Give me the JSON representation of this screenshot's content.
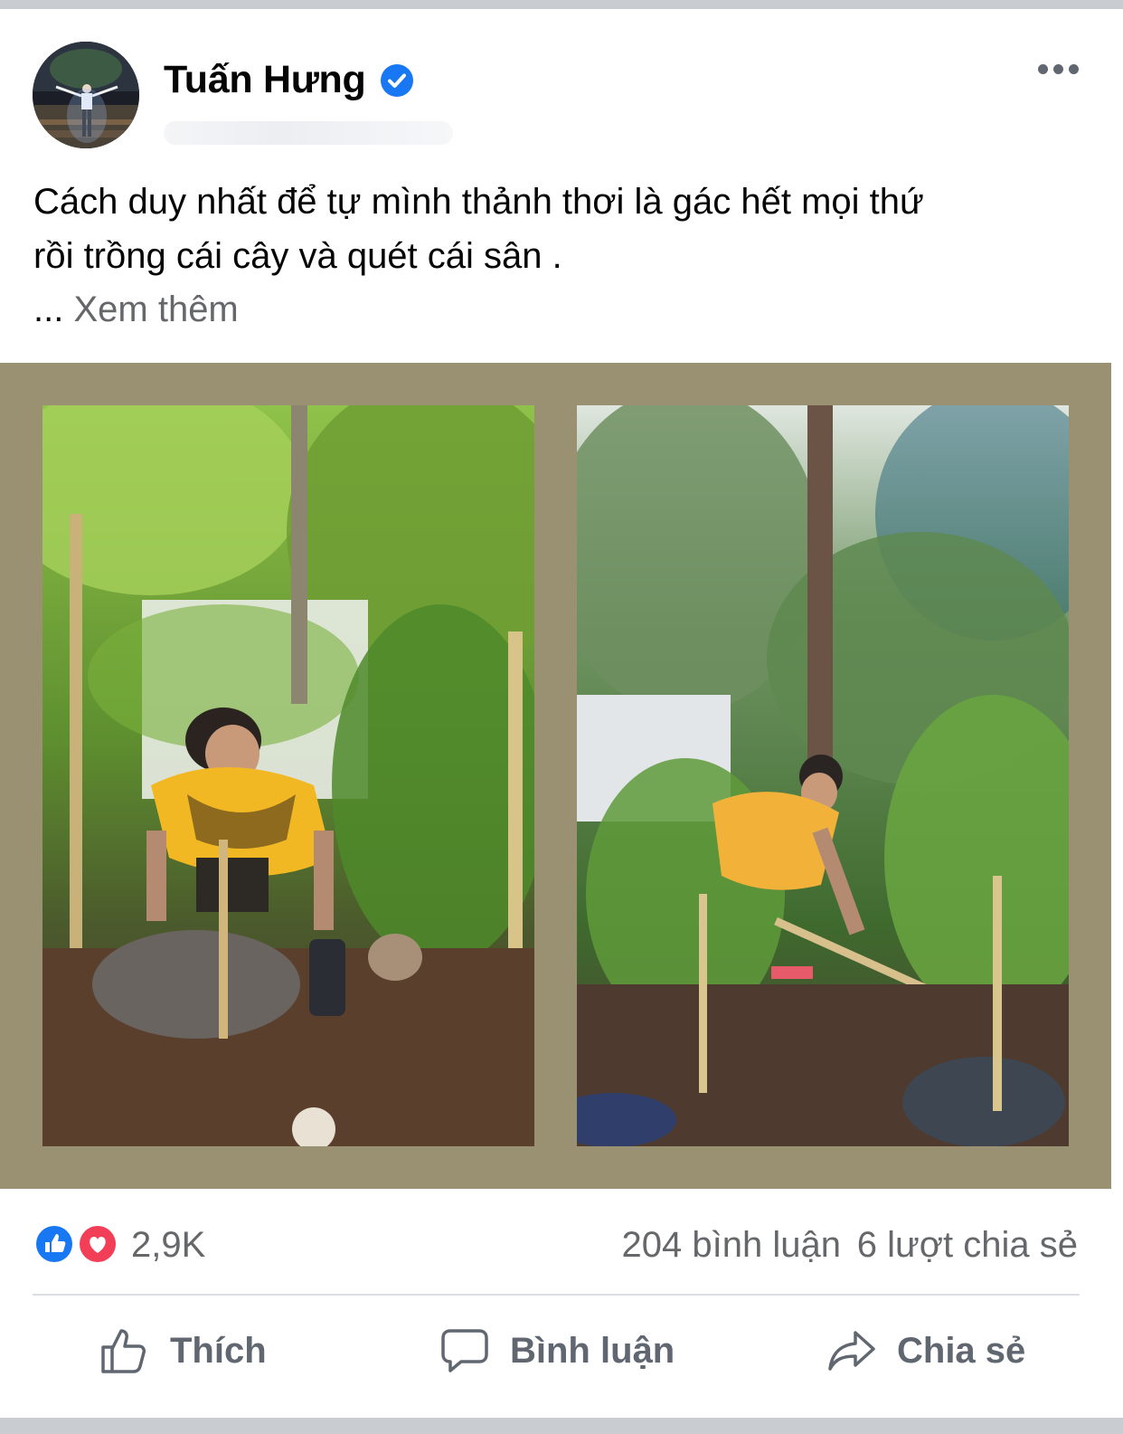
{
  "post": {
    "author": "Tuấn Hưng",
    "text_line_1": "Cách duy nhất để tự mình thảnh thơi là gác hết mọi thứ",
    "text_line_2": "rồi trồng cái cây và quét cái sân .",
    "see_more_prefix": "...",
    "see_more_label": "Xem thêm"
  },
  "photos": [
    {
      "description": "man planting a sapling in garden",
      "icon": "photo"
    },
    {
      "description": "man hoeing soil in garden",
      "icon": "photo"
    }
  ],
  "stats": {
    "reaction_count": "2,9K",
    "reaction_types": [
      "like",
      "love"
    ],
    "comments": "204 bình luận",
    "shares": "6 lượt chia sẻ"
  },
  "actions": {
    "like": "Thích",
    "comment": "Bình luận",
    "share": "Chia sẻ"
  },
  "colors": {
    "like_blue": "#1877f2",
    "love_red": "#f33e58",
    "verified_blue": "#1877f2",
    "photo_frame": "#9a9172",
    "secondary_text": "#65676b"
  }
}
